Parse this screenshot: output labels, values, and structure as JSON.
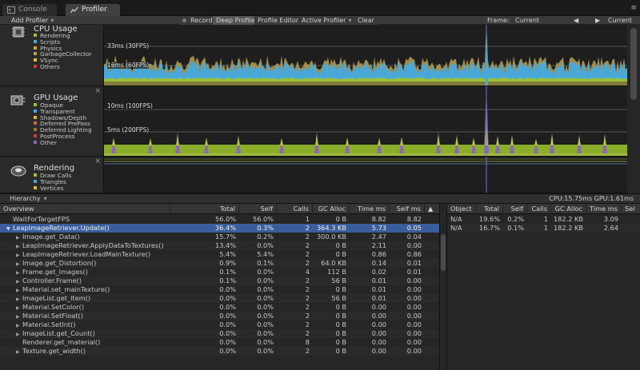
{
  "tabs": [
    {
      "label": "Console",
      "icon": "console-icon"
    },
    {
      "label": "Profiler",
      "icon": "profiler-icon"
    }
  ],
  "menu_icon": "≡",
  "toolbar": {
    "add_profiler": "Add Profiler",
    "record": "Record",
    "deep_profile": "Deep Profile",
    "profile_editor": "Profile Editor",
    "active_profiler": "Active Profiler",
    "clear": "Clear",
    "frame_label": "Frame:",
    "frame_current": "Current",
    "prev_arrow": "◀",
    "next_arrow": "▶",
    "current": "Current"
  },
  "charts": {
    "cpu": {
      "title": "CPU Usage",
      "legend": [
        {
          "label": "Rendering",
          "color": "#9ac13a"
        },
        {
          "label": "Scripts",
          "color": "#4aa8d8"
        },
        {
          "label": "Physics",
          "color": "#e0a030"
        },
        {
          "label": "GarbageCollector",
          "color": "#b8a050"
        },
        {
          "label": "VSync",
          "color": "#d8c030"
        },
        {
          "label": "Others",
          "color": "#c83c3c"
        }
      ],
      "line_33": "33ms (30FPS)",
      "line_16": "16ms (60FPS)"
    },
    "gpu": {
      "title": "GPU Usage",
      "legend": [
        {
          "label": "Opaque",
          "color": "#9ac13a"
        },
        {
          "label": "Transparent",
          "color": "#4aa8d8"
        },
        {
          "label": "Shadows/Depth",
          "color": "#d8b830"
        },
        {
          "label": "Deferred PrePass",
          "color": "#c07030"
        },
        {
          "label": "Deferred Lighting",
          "color": "#a07030"
        },
        {
          "label": "PostProcess",
          "color": "#c83c3c"
        },
        {
          "label": "Other",
          "color": "#8a6ab0"
        }
      ],
      "line_10": "10ms (100FPS)",
      "line_5": "5ms (200FPS)"
    },
    "rendering": {
      "title": "Rendering",
      "legend": [
        {
          "label": "Draw Calls",
          "color": "#9ac13a"
        },
        {
          "label": "Triangles",
          "color": "#4aa8d8"
        },
        {
          "label": "Vertices",
          "color": "#d8b830"
        }
      ]
    }
  },
  "close_glyph": "×",
  "hierarchy": {
    "mode": "Hierarchy",
    "stats": "CPU:15.75ms   GPU:1.61ms"
  },
  "left_table": {
    "columns": [
      "Overview",
      "Total",
      "Self",
      "Calls",
      "GC Alloc",
      "Time ms",
      "Self ms",
      "▲"
    ],
    "rows": [
      {
        "name": "WaitForTargetFPS",
        "depth": 0,
        "expand": "",
        "total": "56.0%",
        "self": "56.0%",
        "calls": "1",
        "gc": "0 B",
        "time": "8.82",
        "selfms": "8.82"
      },
      {
        "name": "LeapImageRetriever.Update()",
        "depth": 0,
        "expand": "▼",
        "total": "36.4%",
        "self": "0.3%",
        "calls": "2",
        "gc": "364.3 KB",
        "time": "5.73",
        "selfms": "0.05",
        "selected": true
      },
      {
        "name": "Image.get_Data()",
        "depth": 1,
        "expand": "▶",
        "total": "15.7%",
        "self": "0.2%",
        "calls": "2",
        "gc": "300.0 KB",
        "time": "2.47",
        "selfms": "0.04"
      },
      {
        "name": "LeapImageRetriever.ApplyDataToTextures()",
        "depth": 1,
        "expand": "▶",
        "total": "13.4%",
        "self": "0.0%",
        "calls": "2",
        "gc": "0 B",
        "time": "2.11",
        "selfms": "0.00"
      },
      {
        "name": "LeapImageRetriever.LoadMainTexture()",
        "depth": 1,
        "expand": "▶",
        "total": "5.4%",
        "self": "5.4%",
        "calls": "2",
        "gc": "0 B",
        "time": "0.86",
        "selfms": "0.86"
      },
      {
        "name": "Image.get_Distortion()",
        "depth": 1,
        "expand": "▶",
        "total": "0.9%",
        "self": "0.1%",
        "calls": "2",
        "gc": "64.0 KB",
        "time": "0.14",
        "selfms": "0.01"
      },
      {
        "name": "Frame.get_Images()",
        "depth": 1,
        "expand": "▶",
        "total": "0.1%",
        "self": "0.0%",
        "calls": "4",
        "gc": "112 B",
        "time": "0.02",
        "selfms": "0.01"
      },
      {
        "name": "Controller.Frame()",
        "depth": 1,
        "expand": "▶",
        "total": "0.1%",
        "self": "0.0%",
        "calls": "2",
        "gc": "56 B",
        "time": "0.01",
        "selfms": "0.00"
      },
      {
        "name": "Material.set_mainTexture()",
        "depth": 1,
        "expand": "▶",
        "total": "0.0%",
        "self": "0.0%",
        "calls": "2",
        "gc": "0 B",
        "time": "0.01",
        "selfms": "0.00"
      },
      {
        "name": "ImageList.get_Item()",
        "depth": 1,
        "expand": "▶",
        "total": "0.0%",
        "self": "0.0%",
        "calls": "2",
        "gc": "56 B",
        "time": "0.01",
        "selfms": "0.00"
      },
      {
        "name": "Material.SetColor()",
        "depth": 1,
        "expand": "▶",
        "total": "0.0%",
        "self": "0.0%",
        "calls": "2",
        "gc": "0 B",
        "time": "0.00",
        "selfms": "0.00"
      },
      {
        "name": "Material.SetFloat()",
        "depth": 1,
        "expand": "▶",
        "total": "0.0%",
        "self": "0.0%",
        "calls": "2",
        "gc": "0 B",
        "time": "0.00",
        "selfms": "0.00"
      },
      {
        "name": "Material.SetInt()",
        "depth": 1,
        "expand": "▶",
        "total": "0.0%",
        "self": "0.0%",
        "calls": "2",
        "gc": "0 B",
        "time": "0.00",
        "selfms": "0.00"
      },
      {
        "name": "ImageList.get_Count()",
        "depth": 1,
        "expand": "▶",
        "total": "0.0%",
        "self": "0.0%",
        "calls": "2",
        "gc": "0 B",
        "time": "0.00",
        "selfms": "0.00"
      },
      {
        "name": "Renderer.get_material()",
        "depth": 1,
        "expand": "",
        "total": "0.0%",
        "self": "0.0%",
        "calls": "8",
        "gc": "0 B",
        "time": "0.00",
        "selfms": "0.00"
      },
      {
        "name": "Texture.get_width()",
        "depth": 1,
        "expand": "▶",
        "total": "0.0%",
        "self": "0.0%",
        "calls": "2",
        "gc": "0 B",
        "time": "0.00",
        "selfms": "0.00"
      }
    ]
  },
  "right_table": {
    "columns": [
      "Object",
      "Total",
      "Self",
      "Calls",
      "GC Alloc",
      "Time ms",
      "Sel"
    ],
    "rows": [
      {
        "object": "N/A",
        "total": "19.6%",
        "self": "0.2%",
        "calls": "1",
        "gc": "182.2 KB",
        "time": "3.09"
      },
      {
        "object": "N/A",
        "total": "16.7%",
        "self": "0.1%",
        "calls": "1",
        "gc": "182.2 KB",
        "time": "2.64"
      }
    ]
  },
  "colors": {
    "rendering": "#9ac13a",
    "scripts": "#4aa8d8",
    "vsync": "#b8a050",
    "spike": "#8a6ab0",
    "selection": "#3a5e9c"
  }
}
